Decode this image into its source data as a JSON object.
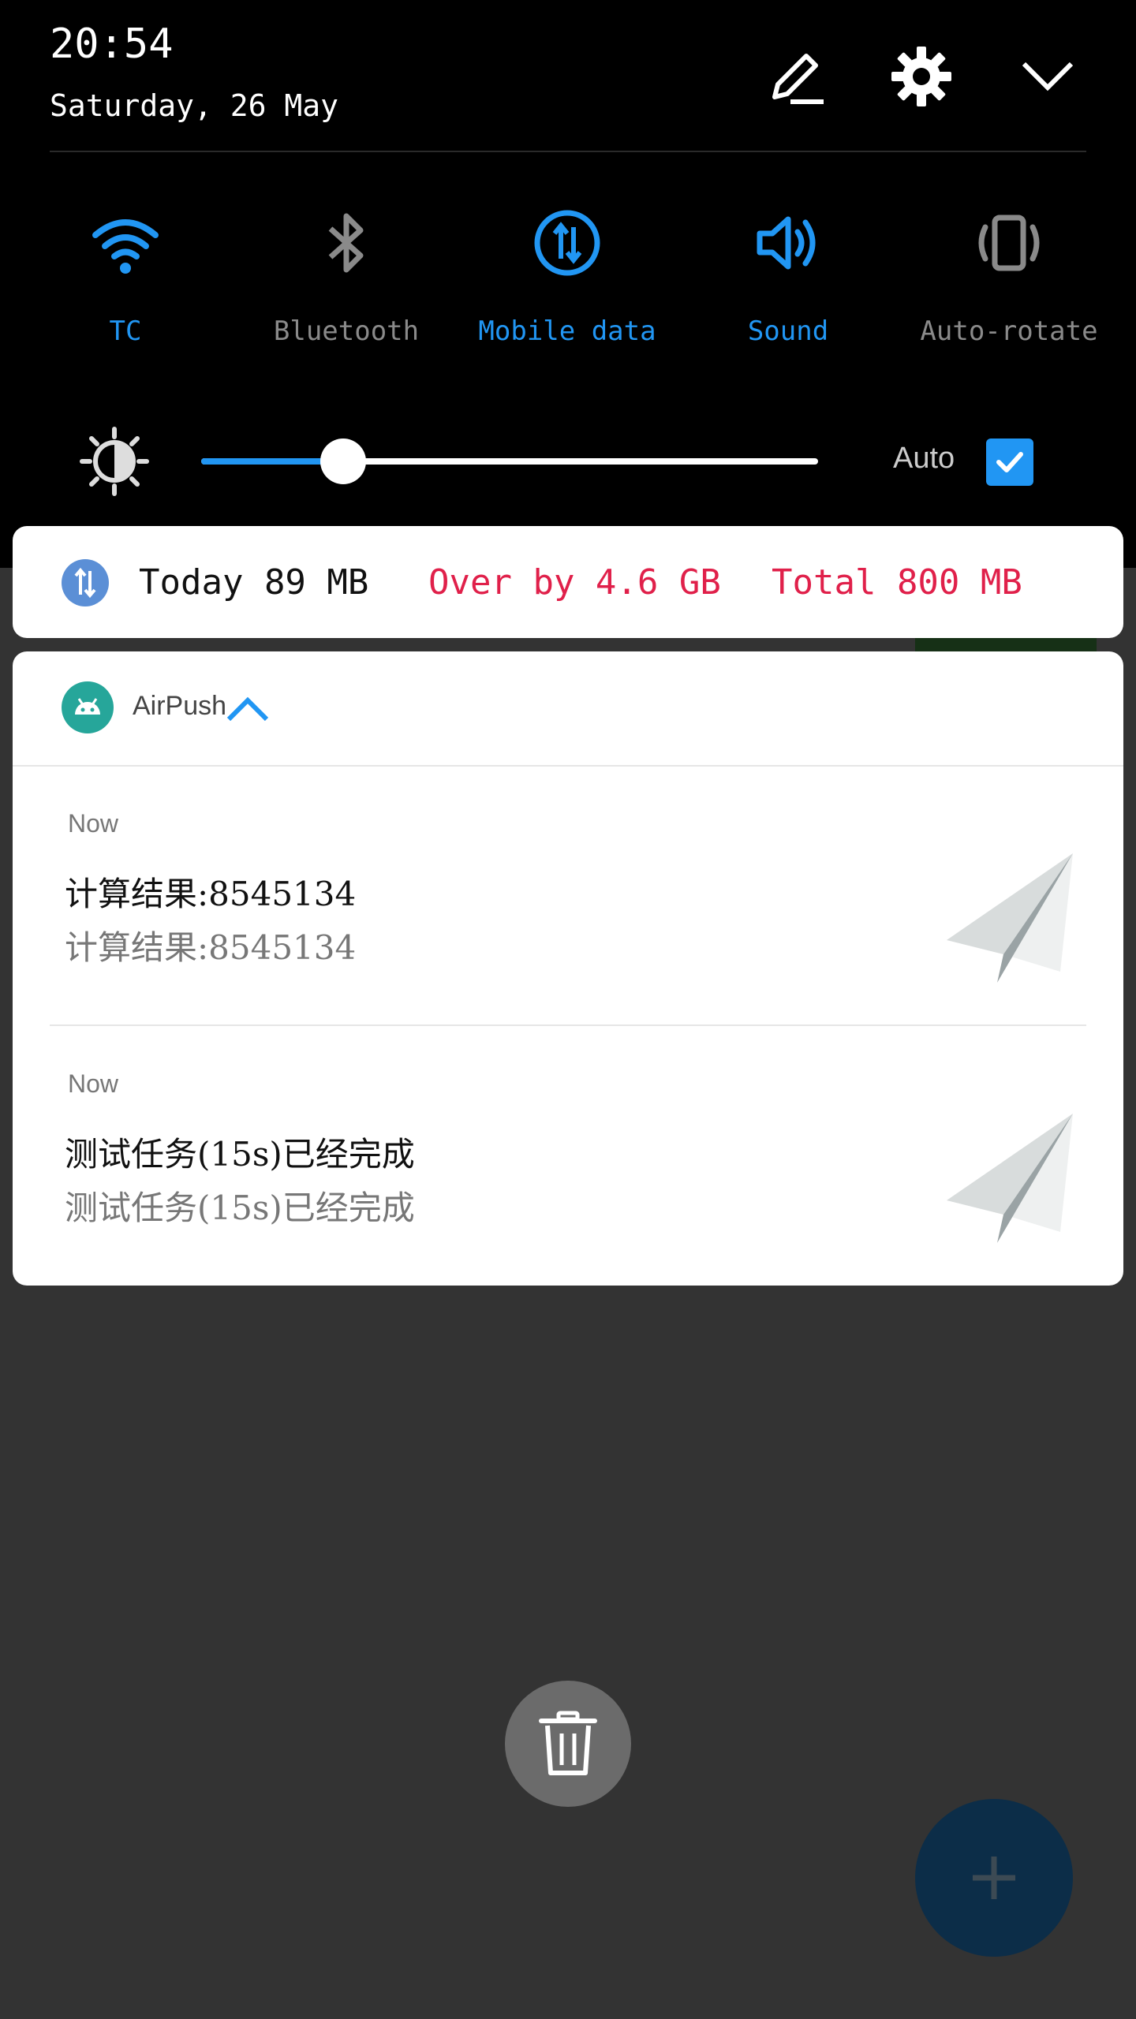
{
  "status": {
    "time": "20:54",
    "date": "Saturday, 26 May"
  },
  "header_actions": [
    {
      "icon": "edit-icon"
    },
    {
      "icon": "gear-icon"
    },
    {
      "icon": "chevron-down-icon"
    }
  ],
  "quick_settings": [
    {
      "label": "TC",
      "icon": "wifi-icon",
      "active": true,
      "color": "#2196f3"
    },
    {
      "label": "Bluetooth",
      "icon": "bluetooth-icon",
      "active": false,
      "color": "#8a8a8a"
    },
    {
      "label": "Mobile data",
      "icon": "mobile-data-icon",
      "active": true,
      "color": "#2196f3"
    },
    {
      "label": "Sound",
      "icon": "sound-icon",
      "active": true,
      "color": "#2196f3"
    },
    {
      "label": "Auto-rotate",
      "icon": "auto-rotate-icon",
      "active": false,
      "color": "#8a8a8a"
    }
  ],
  "brightness": {
    "level": 0.23,
    "auto_label": "Auto",
    "auto_checked": true
  },
  "data_usage": {
    "today": "Today 89 MB",
    "over": "Over by 4.6 GB",
    "total": "Total 800 MB",
    "today_color": "#111111",
    "alert_color": "#e0204a"
  },
  "notification_group": {
    "app_name": "AirPush",
    "items": [
      {
        "time": "Now",
        "title": "计算结果:8545134",
        "body": "计算结果:8545134"
      },
      {
        "time": "Now",
        "title": "测试任务(15s)已经完成",
        "body": "测试任务(15s)已经完成"
      }
    ]
  },
  "colors": {
    "accent": "#2196f3",
    "shade": "#000000",
    "background": "#333333",
    "app_icon": "#26a69a"
  }
}
